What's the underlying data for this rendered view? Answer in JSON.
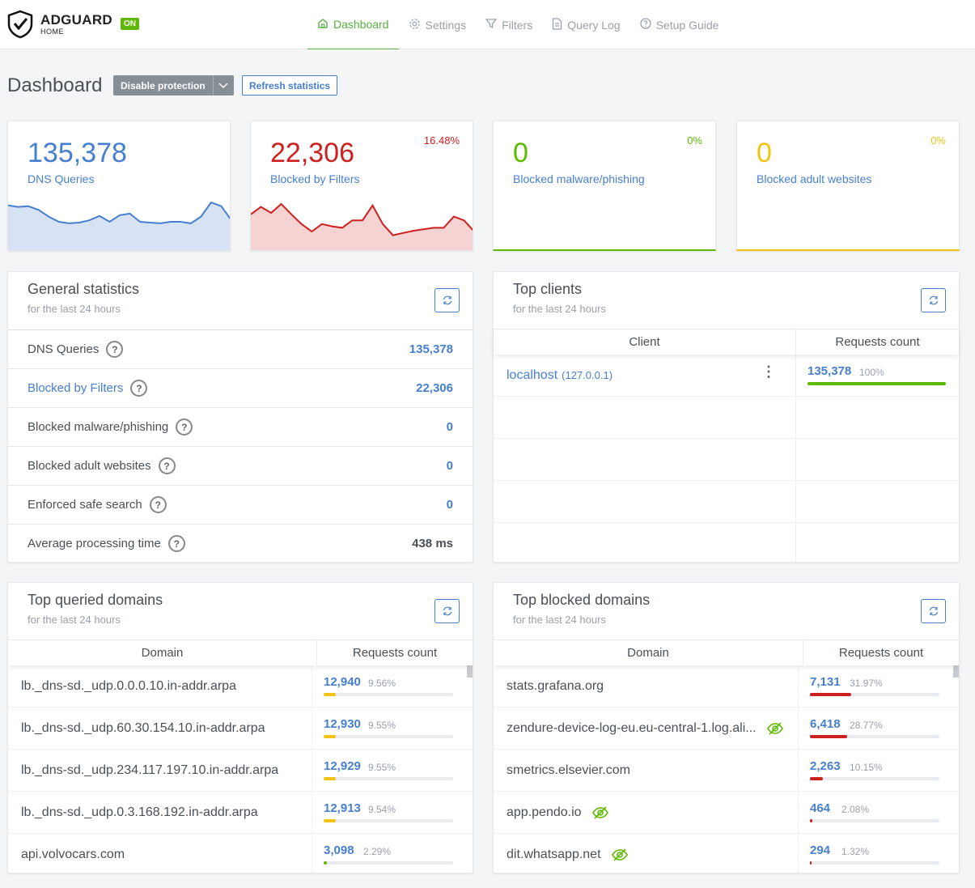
{
  "header": {
    "logo_main": "ADGUARD",
    "logo_sub": "HOME",
    "status_badge": "ON",
    "nav": [
      {
        "label": "Dashboard",
        "icon": "home-icon"
      },
      {
        "label": "Settings",
        "icon": "gear-icon"
      },
      {
        "label": "Filters",
        "icon": "filter-icon"
      },
      {
        "label": "Query Log",
        "icon": "document-icon"
      },
      {
        "label": "Setup Guide",
        "icon": "help-circle-icon"
      }
    ]
  },
  "page": {
    "title": "Dashboard",
    "disable_button": "Disable protection",
    "refresh_button": "Refresh statistics"
  },
  "stats": [
    {
      "value": "135,378",
      "label": "DNS Queries",
      "pct": "",
      "color": "#467fcf"
    },
    {
      "value": "22,306",
      "label": "Blocked by Filters",
      "pct": "16.48%",
      "color": "#cd201f"
    },
    {
      "value": "0",
      "label": "Blocked malware/phishing",
      "pct": "0%",
      "color": "#5eba00"
    },
    {
      "value": "0",
      "label": "Blocked adult websites",
      "pct": "0%",
      "color": "#f1c40f"
    }
  ],
  "sparklines": {
    "dns": [
      0.6,
      0.58,
      0.59,
      0.54,
      0.45,
      0.38,
      0.36,
      0.37,
      0.4,
      0.46,
      0.38,
      0.47,
      0.49,
      0.38,
      0.37,
      0.36,
      0.38,
      0.38,
      0.36,
      0.45,
      0.64,
      0.59,
      0.4
    ],
    "blocked": [
      0.48,
      0.58,
      0.5,
      0.62,
      0.48,
      0.35,
      0.25,
      0.35,
      0.32,
      0.3,
      0.4,
      0.4,
      0.6,
      0.35,
      0.2,
      0.23,
      0.26,
      0.28,
      0.3,
      0.3,
      0.45,
      0.4,
      0.25
    ]
  },
  "general": {
    "title": "General statistics",
    "subtitle": "for the last 24 hours",
    "rows": [
      {
        "label": "DNS Queries",
        "value": "135,378"
      },
      {
        "label": "Blocked by Filters",
        "value": "22,306"
      },
      {
        "label": "Blocked malware/phishing",
        "value": "0"
      },
      {
        "label": "Blocked adult websites",
        "value": "0"
      },
      {
        "label": "Enforced safe search",
        "value": "0"
      },
      {
        "label": "Average processing time",
        "value": "438 ms"
      }
    ]
  },
  "clients": {
    "title": "Top clients",
    "subtitle": "for the last 24 hours",
    "col_client": "Client",
    "col_requests": "Requests count",
    "rows": [
      {
        "name": "localhost",
        "ip": "(127.0.0.1)",
        "count": "135,378",
        "pct": "100%",
        "fraction": 1.0
      }
    ]
  },
  "queried": {
    "title": "Top queried domains",
    "subtitle": "for the last 24 hours",
    "col_domain": "Domain",
    "col_requests": "Requests count",
    "rows": [
      {
        "domain": "lb._dns-sd._udp.0.0.0.10.in-addr.arpa",
        "count": "12,940",
        "pct": "9.56%",
        "fraction": 0.0956
      },
      {
        "domain": "lb._dns-sd._udp.60.30.154.10.in-addr.arpa",
        "count": "12,930",
        "pct": "9.55%",
        "fraction": 0.0955
      },
      {
        "domain": "lb._dns-sd._udp.234.117.197.10.in-addr.arpa",
        "count": "12,929",
        "pct": "9.55%",
        "fraction": 0.0955
      },
      {
        "domain": "lb._dns-sd._udp.0.3.168.192.in-addr.arpa",
        "count": "12,913",
        "pct": "9.54%",
        "fraction": 0.0954
      },
      {
        "domain": "api.volvocars.com",
        "count": "3,098",
        "pct": "2.29%",
        "fraction": 0.0229
      }
    ]
  },
  "blocked": {
    "title": "Top blocked domains",
    "subtitle": "for the last 24 hours",
    "col_domain": "Domain",
    "col_requests": "Requests count",
    "rows": [
      {
        "domain": "stats.grafana.org",
        "count": "7,131",
        "pct": "31.97%",
        "fraction": 0.3197,
        "eye": false
      },
      {
        "domain": "zendure-device-log-eu.eu-central-1.log.ali...",
        "count": "6,418",
        "pct": "28.77%",
        "fraction": 0.2877,
        "eye": true
      },
      {
        "domain": "smetrics.elsevier.com",
        "count": "2,263",
        "pct": "10.15%",
        "fraction": 0.1015,
        "eye": false
      },
      {
        "domain": "app.pendo.io",
        "count": "464",
        "pct": "2.08%",
        "fraction": 0.0208,
        "eye": true
      },
      {
        "domain": "dit.whatsapp.net",
        "count": "294",
        "pct": "1.32%",
        "fraction": 0.0132,
        "eye": true
      }
    ]
  }
}
